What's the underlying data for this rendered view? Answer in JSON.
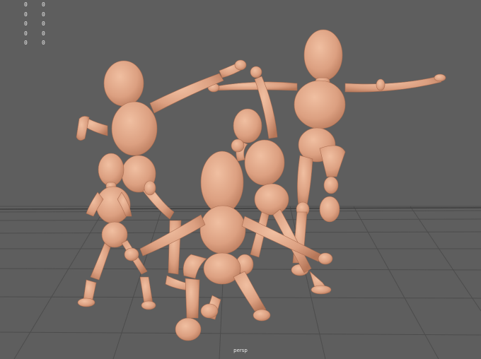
{
  "viewport": {
    "camera_name": "persp",
    "background_color": "#5e5e5e",
    "grid_color": "#4a4a4a",
    "model_color": "#e5a888",
    "model_shadow_color": "#b97a5b"
  },
  "hud": {
    "rows": [
      {
        "a": "0",
        "b": "0"
      },
      {
        "a": "0",
        "b": "0"
      },
      {
        "a": "0",
        "b": "0"
      },
      {
        "a": "0",
        "b": "0"
      },
      {
        "a": "0",
        "b": "0"
      }
    ]
  },
  "scene": {
    "characters": [
      {
        "name": "character-dab"
      },
      {
        "name": "character-small-left"
      },
      {
        "name": "character-crouch-front"
      },
      {
        "name": "character-reaching-middle"
      },
      {
        "name": "character-tpose-right"
      }
    ]
  }
}
